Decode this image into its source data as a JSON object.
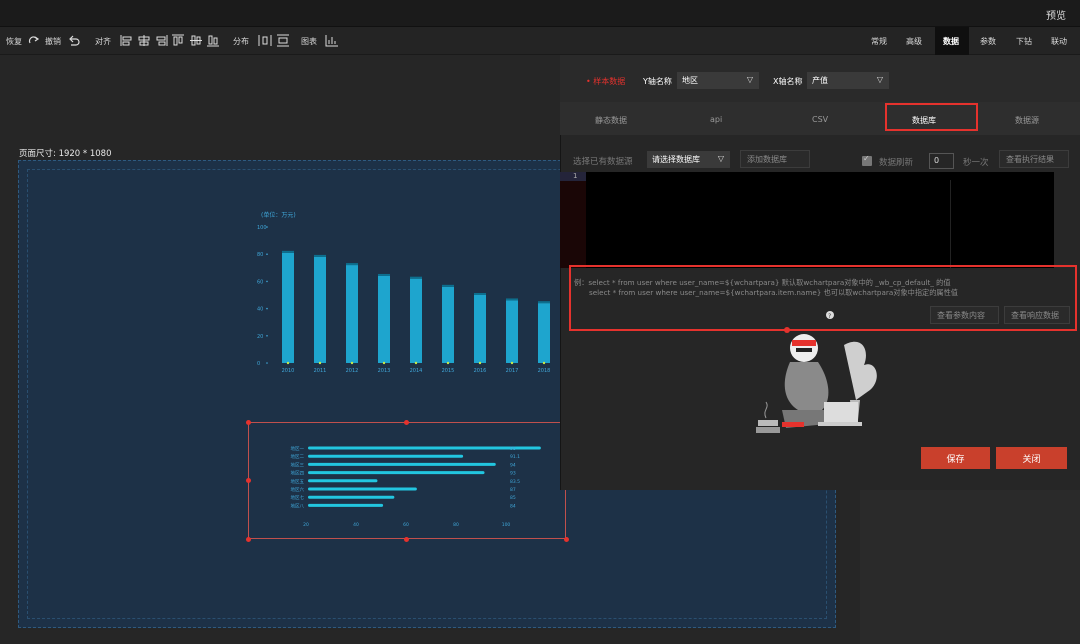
{
  "topbar": {
    "preview": "预览"
  },
  "toolbar": {
    "redo": "恢复",
    "undo": "撤销",
    "align": "对齐",
    "distribute": "分布",
    "chart": "图表"
  },
  "right_tabs": [
    "常规",
    "高级",
    "数据",
    "参数",
    "下钻",
    "联动"
  ],
  "canvas": {
    "page_size": "页面尺寸: 1920 * 1080"
  },
  "bar_chart": {
    "type": "bar",
    "unit": "(单位：万元)",
    "categories": [
      "2010",
      "2011",
      "2012",
      "2013",
      "2014",
      "2015",
      "2016",
      "2017",
      "2018"
    ],
    "values": [
      81,
      78,
      72,
      64,
      62,
      56,
      50,
      46,
      44
    ],
    "yticks": [
      "100",
      "80",
      "60",
      "40",
      "20",
      "0"
    ],
    "ylim": [
      0,
      100
    ]
  },
  "hbar_chart": {
    "type": "bar",
    "categories": [
      "地区一",
      "地区二",
      "地区三",
      "地区四",
      "地区五",
      "地区六",
      "地区七",
      "地区八"
    ],
    "values": [
      98,
      91.1,
      94,
      93,
      83.5,
      87,
      85,
      84
    ],
    "value_labels": [
      "98",
      "91.1",
      "94",
      "93",
      "83.5",
      "87",
      "85",
      "84"
    ],
    "xticks": [
      "20",
      "40",
      "60",
      "80",
      "100"
    ]
  },
  "panel": {
    "sample_label": "• 样本数据",
    "y_label": "Y轴名称",
    "y_value": "地区",
    "x_label": "X轴名称",
    "x_value": "产值",
    "tabs": [
      "静态数据",
      "api",
      "CSV",
      "数据库",
      "数据源"
    ],
    "choose_label": "选择已有数据源",
    "choose_value": "请选择数据库",
    "add_db": "添加数据库",
    "refresh_label": "数据刷新",
    "refresh_value": "0",
    "per_second": "秒一次",
    "view_exec": "查看执行结果",
    "line_no": "1",
    "hint1": "例：select * from user where user_name=${wchartpara} 默认取wchartpara对象中的 _wb_cp_default_ 的值",
    "hint2": "select * from user where user_name=${wchartpara.item.name} 也可以取wchartpara对象中指定的属性值",
    "view_params": "查看参数内容",
    "view_response": "查看响应数据",
    "save": "保存",
    "close": "关闭"
  },
  "colors": {
    "accent_red": "#e5322d",
    "button_red": "#c9402c",
    "bar_cyan": "#1fb3dd"
  }
}
